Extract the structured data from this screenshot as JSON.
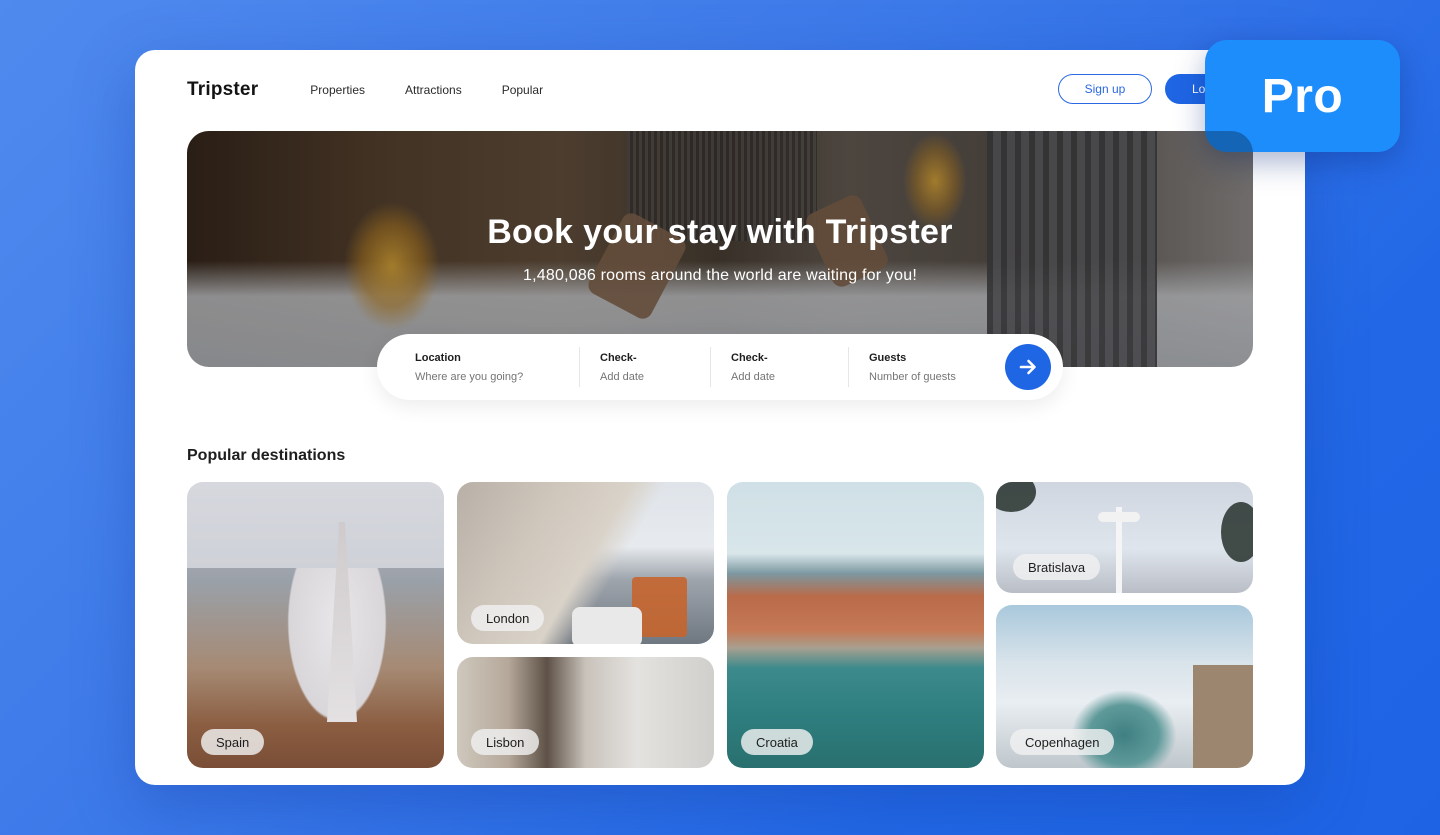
{
  "nav": {
    "logo": "Tripster",
    "links": [
      "Properties",
      "Attractions",
      "Popular"
    ],
    "signup_label": "Sign up",
    "login_label": "Lo"
  },
  "hero": {
    "title": "Book your stay with Tripster",
    "subtitle": "1,480,086 rooms around the world are waiting for you!"
  },
  "search": {
    "fields": [
      {
        "label": "Location",
        "placeholder": "Where are you going?"
      },
      {
        "label": "Check-",
        "placeholder": "Add date"
      },
      {
        "label": "Check-",
        "placeholder": "Add date"
      },
      {
        "label": "Guests",
        "placeholder": "Number of guests"
      }
    ],
    "submit_icon": "arrow-right-icon"
  },
  "destinations": {
    "title": "Popular destinations",
    "items": [
      {
        "name": "Spain"
      },
      {
        "name": "London"
      },
      {
        "name": "Lisbon"
      },
      {
        "name": "Croatia"
      },
      {
        "name": "Bratislava"
      },
      {
        "name": "Copenhagen"
      }
    ]
  },
  "badge": {
    "label": "Pro"
  },
  "colors": {
    "accent": "#1f66e5",
    "badge": "#1e8dfc",
    "background": "#3d7ae9"
  }
}
